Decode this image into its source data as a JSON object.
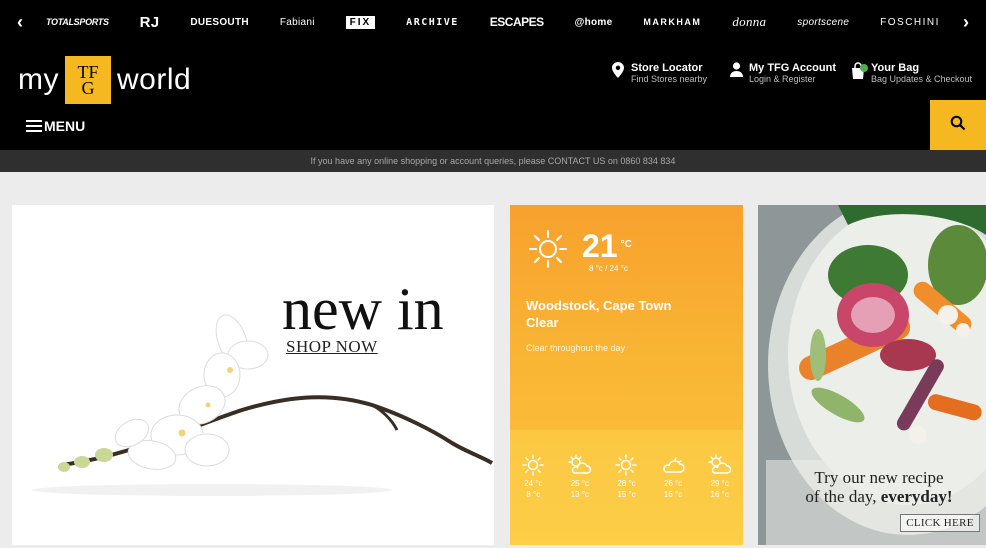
{
  "brands": {
    "prev_label": "‹",
    "next_label": "›",
    "items": [
      "TOTALSPORTS",
      "RJ",
      "DUESOUTH",
      "Fabiani",
      "FIX",
      "ARCHIVE",
      "ESCAPES",
      "@home",
      "MARKHAM",
      "donna",
      "sportscene",
      "FOSCHINI"
    ]
  },
  "header": {
    "logo": {
      "left": "my",
      "badge_top": "TF",
      "badge_bottom": "G",
      "right": "world"
    },
    "store_locator": {
      "title": "Store Locator",
      "subtitle": "Find Stores nearby"
    },
    "account": {
      "title": "My TFG Account",
      "subtitle": "Login & Register"
    },
    "bag": {
      "title": "Your Bag",
      "subtitle": "Bag Updates & Checkout"
    },
    "menu_label": "MENU"
  },
  "infobar": {
    "text": "If you have any online shopping or account queries, please CONTACT US on 0860 834 834"
  },
  "hero": {
    "title": "new in",
    "link": "SHOP NOW"
  },
  "weather": {
    "temperature": "21",
    "unit": "°C",
    "range": "8 °c / 24 °c",
    "location": "Woodstock, Cape Town",
    "condition": "Clear",
    "description": "Clear throughout the day",
    "forecast": [
      {
        "icon": "sun-icon",
        "high": "24 °c",
        "low": "8 °c"
      },
      {
        "icon": "partly-cloudy-icon",
        "high": "25 °c",
        "low": "13 °c"
      },
      {
        "icon": "sun-icon",
        "high": "28 °c",
        "low": "15 °c"
      },
      {
        "icon": "cloudy-icon",
        "high": "26 °c",
        "low": "16 °c"
      },
      {
        "icon": "partly-cloudy-icon",
        "high": "29 °c",
        "low": "16 °c"
      }
    ]
  },
  "recipe": {
    "line1": "Try our new recipe",
    "line2": "of the day,",
    "line2_bold": "everyday!",
    "button": "CLICK HERE"
  },
  "colors": {
    "accent": "#f5b820",
    "header_bg": "#000000",
    "infobar_bg": "#2f2f2f",
    "weather_orange": "#f7a12d"
  }
}
